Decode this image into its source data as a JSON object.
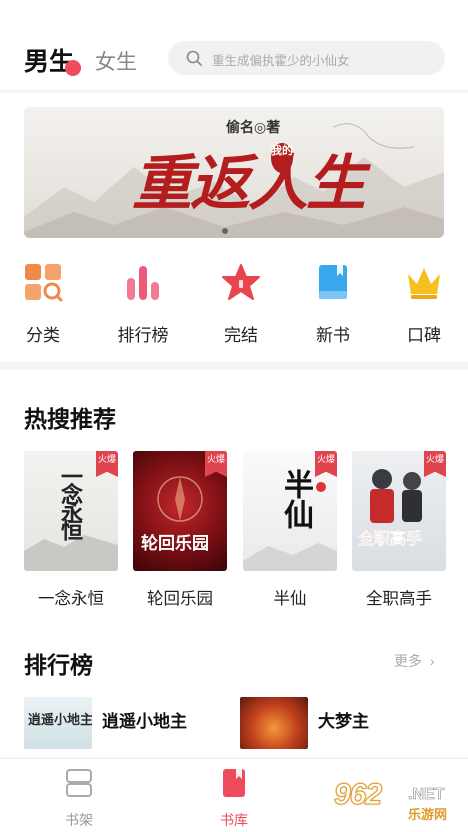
{
  "header": {
    "tab_male": "男生",
    "tab_female": "女生",
    "search_placeholder": "重生成偏执霍少的小仙女"
  },
  "banner": {
    "author": "偷名◎著",
    "title": "重返人生",
    "title_small": "我的",
    "page_indicator": "1"
  },
  "categories": [
    {
      "label": "分类",
      "icon": "category-grid-icon",
      "color": "#f08a4b"
    },
    {
      "label": "排行榜",
      "icon": "bar-ranking-icon",
      "color": "#ee5b7a"
    },
    {
      "label": "完结",
      "icon": "star-icon",
      "color": "#e9454f"
    },
    {
      "label": "新书",
      "icon": "book-icon",
      "color": "#3aa6ee"
    },
    {
      "label": "口碑",
      "icon": "crown-icon",
      "color": "#f5c020"
    }
  ],
  "hot_search": {
    "title": "热搜推荐",
    "badge": "火爆",
    "books": [
      {
        "title": "一念永恒",
        "cover_text": "一念永恒"
      },
      {
        "title": "轮回乐园",
        "cover_text": "轮回乐园"
      },
      {
        "title": "半仙",
        "cover_text": "半仙"
      },
      {
        "title": "全职高手",
        "cover_text": "全职高手"
      }
    ]
  },
  "ranking": {
    "title": "排行榜",
    "more": "更多",
    "items": [
      {
        "title": "逍遥小地主",
        "cover_text": "逍遥小地主"
      },
      {
        "title": "大梦主",
        "cover_text": ""
      }
    ]
  },
  "bottom_nav": [
    {
      "label": "书架",
      "icon": "bookshelf-icon",
      "active": false
    },
    {
      "label": "书库",
      "icon": "library-icon",
      "active": true
    }
  ],
  "watermark": {
    "num": "962",
    "net": ".NET",
    "cn": "乐游网"
  },
  "colors": {
    "accent": "#ee4b5c",
    "banner_red": "#b41d1d"
  }
}
